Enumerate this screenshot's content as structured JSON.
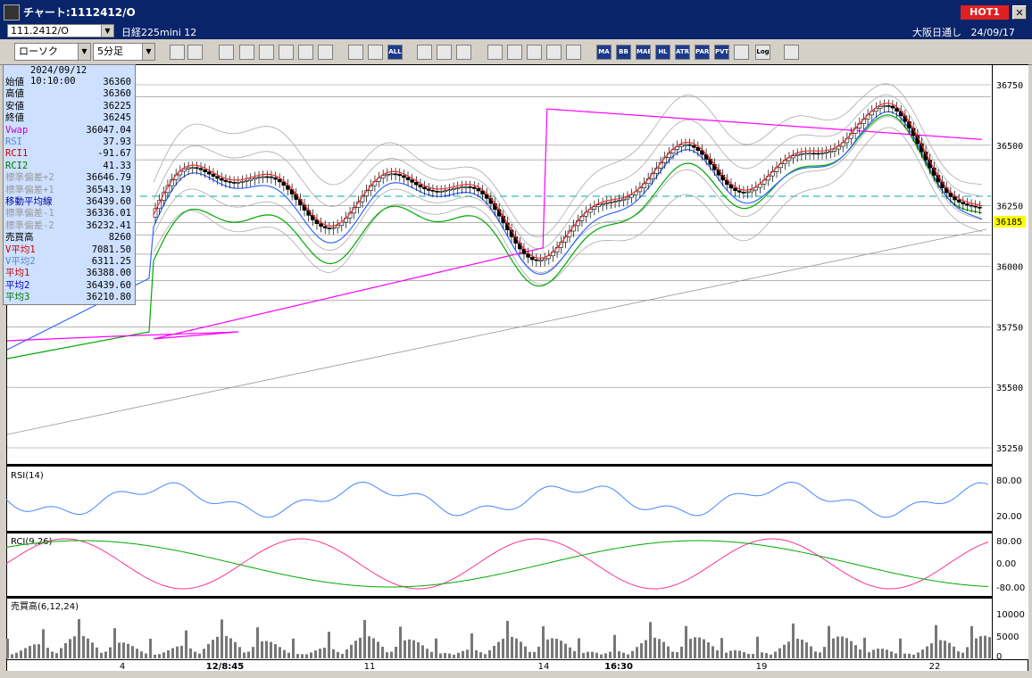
{
  "window": {
    "title": "チャート:1112412/O",
    "hot_label": "HOT1",
    "close_glyph": "✕"
  },
  "header": {
    "symbol_code": "111.2412/O",
    "symbol_name": "日経225mini 12",
    "market": "大阪日通し",
    "date": "24/09/17"
  },
  "toolbar": {
    "chart_type": "ローソク",
    "interval": "5分足",
    "buttons": [
      "zoom-icon",
      "cursor-icon",
      "pencil-icon",
      "edit-icon",
      "pointer-icon",
      "arrow-icon",
      "page-icon",
      "trash-icon",
      "sound-icon",
      "alert-icon",
      "ALL",
      "gear-icon",
      "wrench-icon",
      "palette-icon",
      "download-icon",
      "search-icon",
      "bar-icon",
      "cross-icon",
      "text-icon",
      "MA",
      "BB",
      "MAE",
      "HL",
      "ATR",
      "PAR",
      "PVT",
      "print-icon",
      "Log",
      "export-icon"
    ]
  },
  "info": {
    "datetime": "2024/09/12  10:10:00",
    "rows": [
      {
        "label": "始値",
        "value": "36360",
        "color": "#000000"
      },
      {
        "label": "高値",
        "value": "36360",
        "color": "#000000"
      },
      {
        "label": "安値",
        "value": "36225",
        "color": "#000000"
      },
      {
        "label": "終値",
        "value": "36245",
        "color": "#000000"
      },
      {
        "label": "Vwap",
        "value": "36047.04",
        "color": "#cc00cc"
      },
      {
        "label": "RSI",
        "value": "37.93",
        "color": "#5588cc"
      },
      {
        "label": "RCI1",
        "value": "-91.67",
        "color": "#cc0000"
      },
      {
        "label": "RCI2",
        "value": "41.33",
        "color": "#007700"
      },
      {
        "label": "標準偏差+2",
        "value": "36646.79",
        "color": "#999999"
      },
      {
        "label": "標準偏差+1",
        "value": "36543.19",
        "color": "#999999"
      },
      {
        "label": "移動平均線",
        "value": "36439.60",
        "color": "#000099"
      },
      {
        "label": "標準偏差-1",
        "value": "36336.01",
        "color": "#999999"
      },
      {
        "label": "標準偏差-2",
        "value": "36232.41",
        "color": "#999999"
      },
      {
        "label": "売買高",
        "value": "8260",
        "color": "#000000"
      },
      {
        "label": "V平均1",
        "value": "7081.50",
        "color": "#cc0000"
      },
      {
        "label": "V平均2",
        "value": "6311.25",
        "color": "#5588cc"
      },
      {
        "label": "平均1",
        "value": "36388.00",
        "color": "#cc0000"
      },
      {
        "label": "平均2",
        "value": "36439.60",
        "color": "#0000cc"
      },
      {
        "label": "平均3",
        "value": "36210.80",
        "color": "#007700"
      }
    ]
  },
  "chart": {
    "price_ticks": [
      "36750",
      "36500",
      "36250",
      "36000",
      "35750",
      "35500",
      "35250"
    ],
    "last_price": "36185",
    "rsi": {
      "title": "RSI(14)",
      "ticks": [
        "80.00",
        "20.00"
      ],
      "color": "#4488ff"
    },
    "rci": {
      "title": "RCI(9,26)",
      "ticks": [
        "80.00",
        "0.00",
        "-80.00"
      ],
      "color1": "#ff3399",
      "color2": "#00aa00"
    },
    "volume": {
      "title": "売買高(6,12,24)",
      "ticks": [
        "10000",
        "5000",
        "0"
      ]
    },
    "x_labels": [
      "4",
      "12/8:45",
      "11",
      "14",
      "16:30",
      "19",
      "22"
    ],
    "colors": {
      "ma1": "#ff2222",
      "ma2": "#3366ff",
      "ma3": "#00aa00",
      "vwap": "#ff00ff",
      "band": "#aaaaaa",
      "dash": "#00aaaa",
      "trend": "#999999",
      "price_tag": "#ffff00"
    }
  }
}
